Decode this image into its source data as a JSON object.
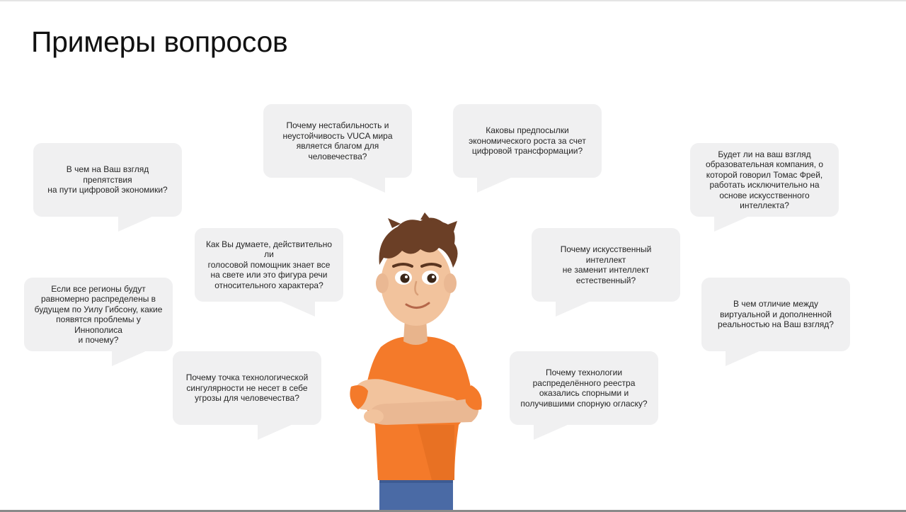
{
  "slide": {
    "title": "Примеры вопросов"
  },
  "questions": [
    {
      "lines": [
        "В чем на Ваш взгляд препятствия",
        "на пути цифровой экономики?"
      ]
    },
    {
      "lines": [
        "Почему нестабильность и",
        "неустойчивость VUCA мира",
        "является благом для",
        "человечества?"
      ]
    },
    {
      "lines": [
        "Каковы предпосылки",
        "экономического роста за счет",
        "цифровой трансформации?"
      ]
    },
    {
      "lines": [
        "Будет ли на ваш взгляд",
        "образовательная компания, о",
        "которой говорил Томас Фрей,",
        "работать исключительно на",
        "основе искусственного",
        "интеллекта?"
      ]
    },
    {
      "lines": [
        "Как Вы думаете, действительно ли",
        "голосовой помощник знает все",
        "на свете или это фигура речи",
        "относительного характера?"
      ]
    },
    {
      "lines": [
        "Почему искусственный интеллект",
        "не заменит интеллект",
        "естественный?"
      ]
    },
    {
      "lines": [
        "Если все регионы будут",
        "равномерно распределены в",
        "будущем по Уилу Гибсону, какие",
        "появятся проблемы у Иннополиса",
        "и почему?"
      ]
    },
    {
      "lines": [
        "В чем отличие между",
        "виртуальной и дополненной",
        "реальностью на Ваш взгляд?"
      ]
    },
    {
      "lines": [
        "Почему точка технологической",
        "сингулярности не несет в себе",
        "угрозы для человечества?"
      ]
    },
    {
      "lines": [
        "Почему технологии",
        "распределённого реестра",
        "оказались спорными и",
        "получившими спорную огласку?"
      ]
    }
  ],
  "colors": {
    "bubble": "#f0f0f1",
    "shirt": "#f47a2a",
    "hair": "#6b3f26",
    "skin": "#f2c39d",
    "jeans": "#4a6aa5"
  },
  "icons": {
    "character": "cartoon-young-man-arms-crossed"
  }
}
